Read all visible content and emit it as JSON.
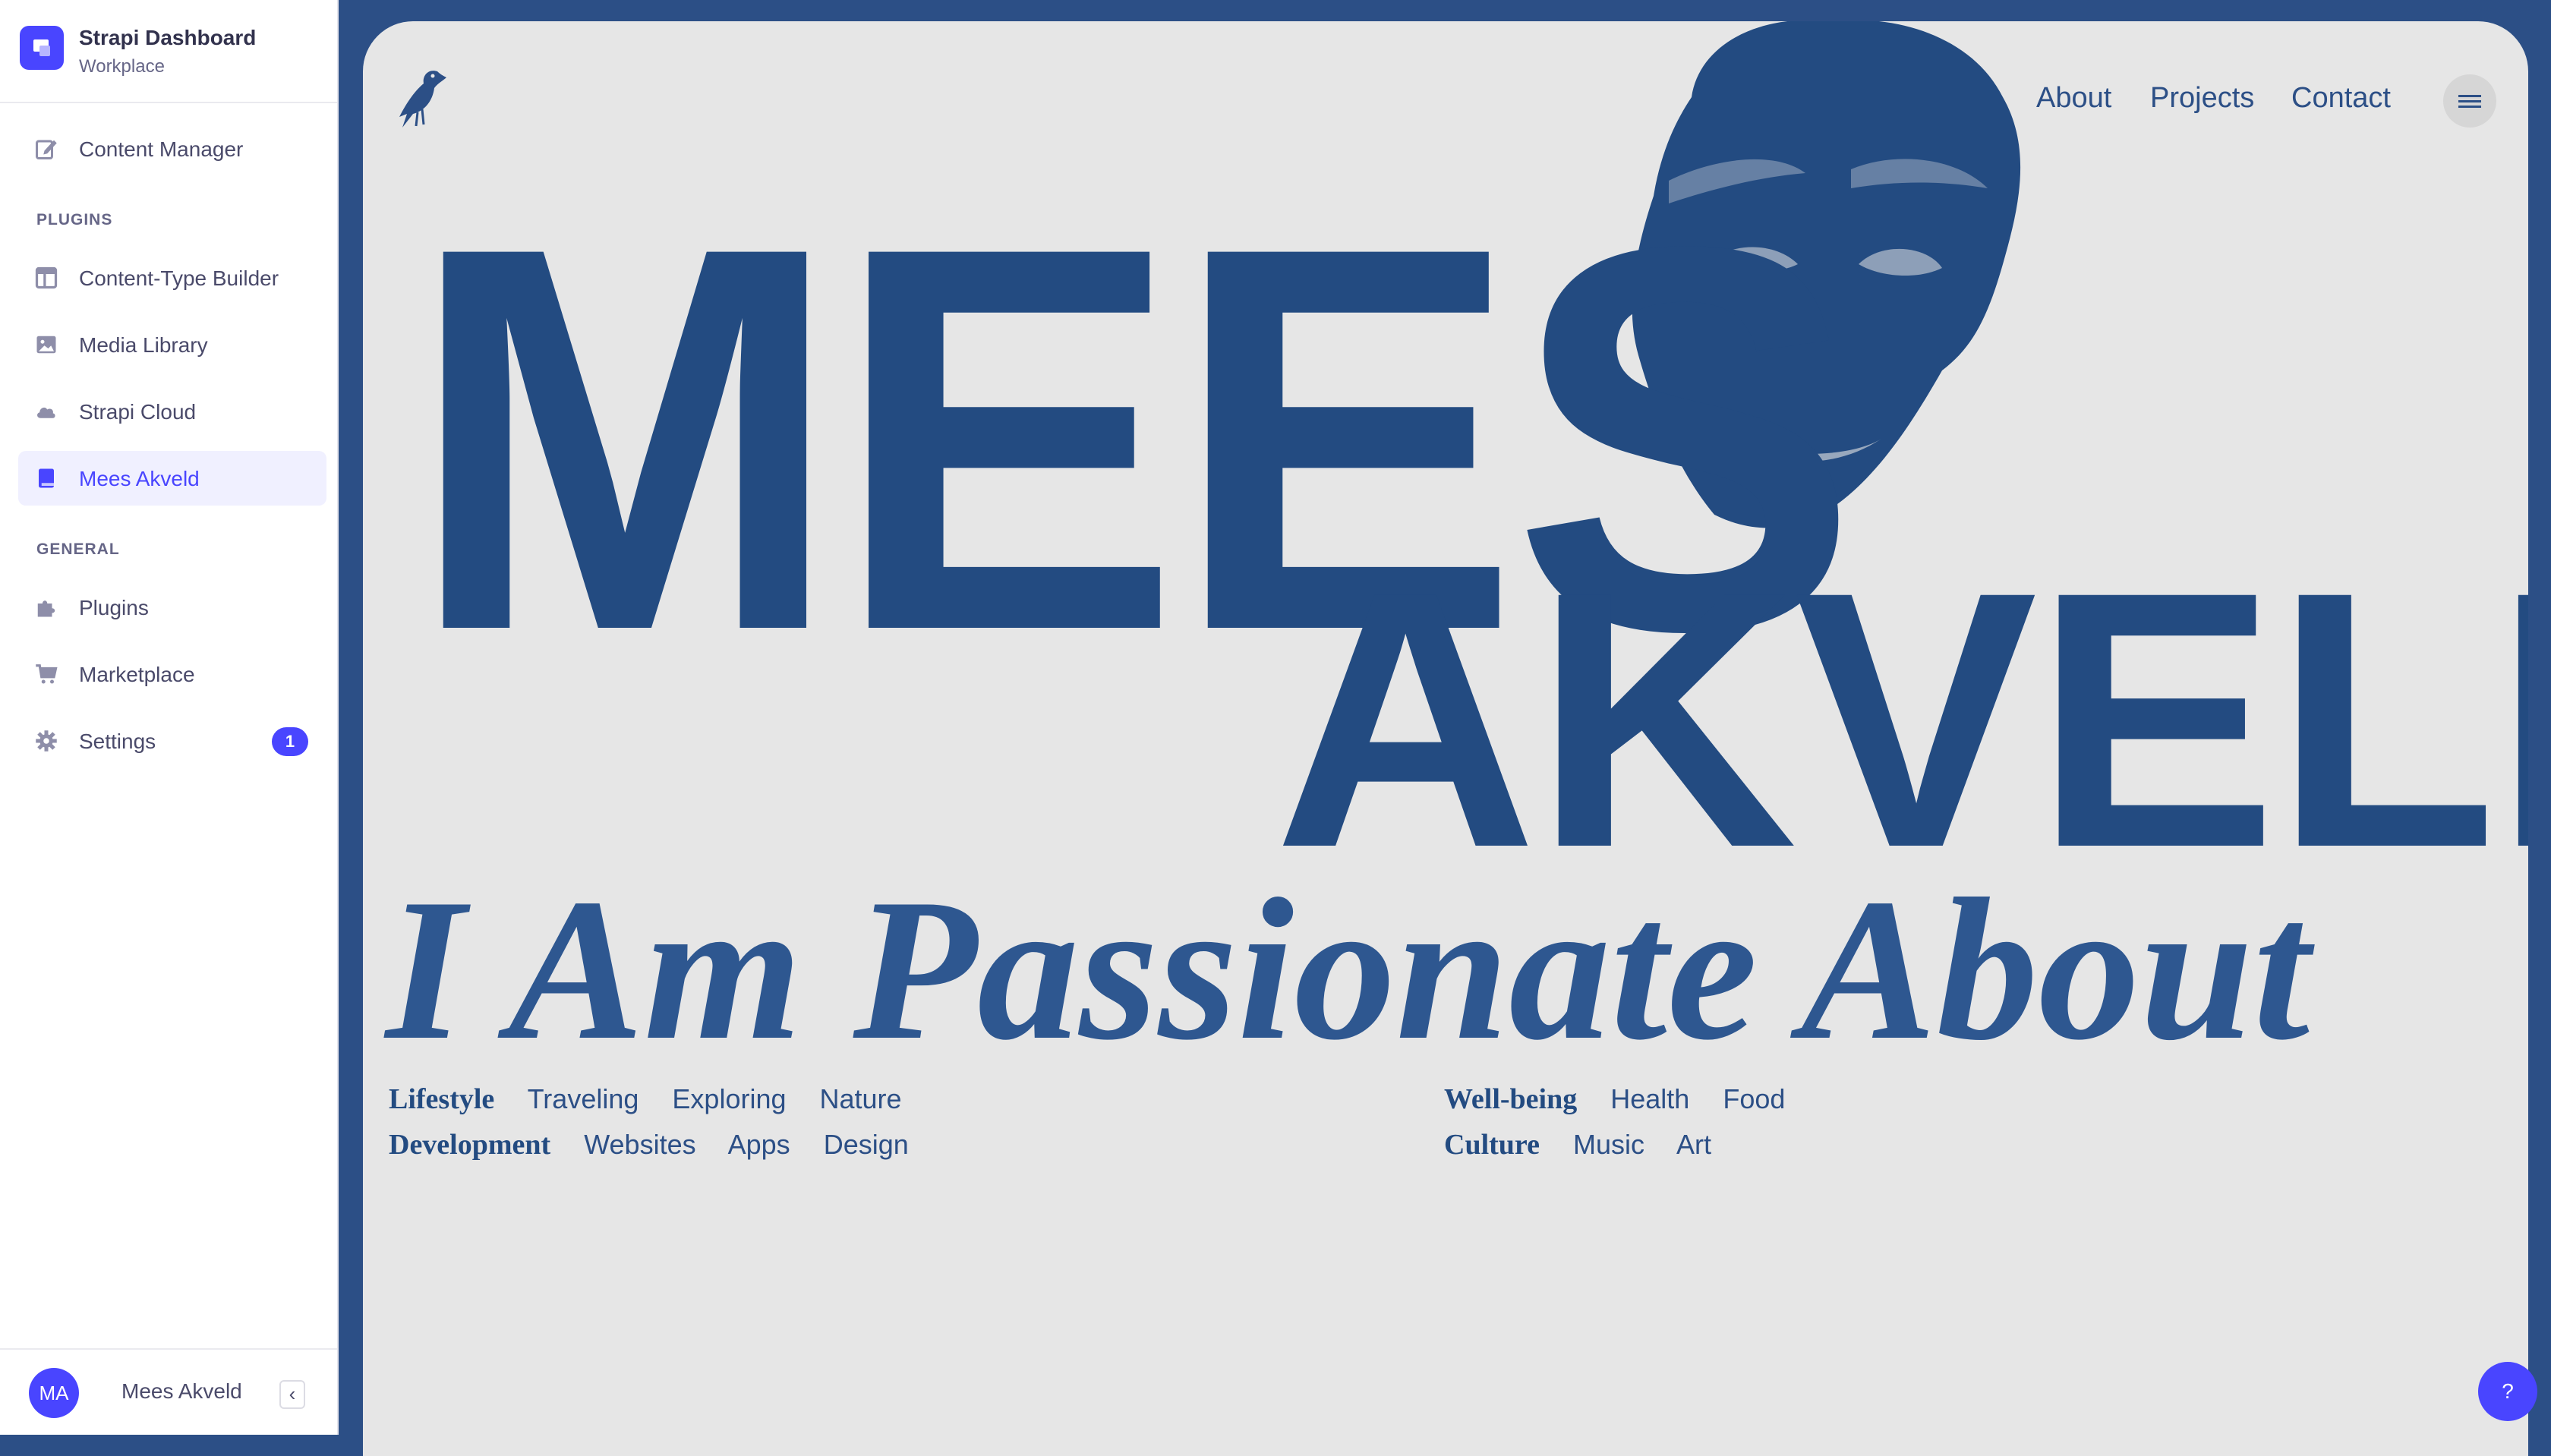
{
  "brand": {
    "title": "Strapi Dashboard",
    "subtitle": "Workplace"
  },
  "sidebar": {
    "top_items": [
      {
        "label": "Content Manager",
        "icon": "pencil-square-icon"
      }
    ],
    "plugins_heading": "PLUGINS",
    "plugin_items": [
      {
        "label": "Content-Type Builder",
        "icon": "layout-icon"
      },
      {
        "label": "Media Library",
        "icon": "image-icon"
      },
      {
        "label": "Strapi Cloud",
        "icon": "cloud-icon"
      },
      {
        "label": "Mees Akveld",
        "icon": "book-icon",
        "active": true
      }
    ],
    "general_heading": "GENERAL",
    "general_items": [
      {
        "label": "Plugins",
        "icon": "puzzle-icon"
      },
      {
        "label": "Marketplace",
        "icon": "cart-icon"
      },
      {
        "label": "Settings",
        "icon": "gear-icon",
        "badge": "1"
      }
    ],
    "footer": {
      "initials": "MA",
      "name": "Mees Akveld",
      "collapse_glyph": "‹"
    }
  },
  "site": {
    "nav": [
      "About",
      "Projects",
      "Contact"
    ],
    "hero_first": "MEES",
    "hero_last": "AKVELD",
    "tagline": "I Am Passionate About",
    "interests": [
      {
        "category": "Lifestyle",
        "tags": [
          "Traveling",
          "Exploring",
          "Nature"
        ]
      },
      {
        "category": "Development",
        "tags": [
          "Websites",
          "Apps",
          "Design"
        ]
      },
      {
        "category": "Well-being",
        "tags": [
          "Health",
          "Food"
        ]
      },
      {
        "category": "Culture",
        "tags": [
          "Music",
          "Art"
        ]
      }
    ]
  },
  "help": {
    "glyph": "?"
  },
  "colors": {
    "accent": "#4945ff",
    "site_blue": "#234b81",
    "site_bg": "#e6e6e6",
    "frame_border": "#2c4f86"
  }
}
